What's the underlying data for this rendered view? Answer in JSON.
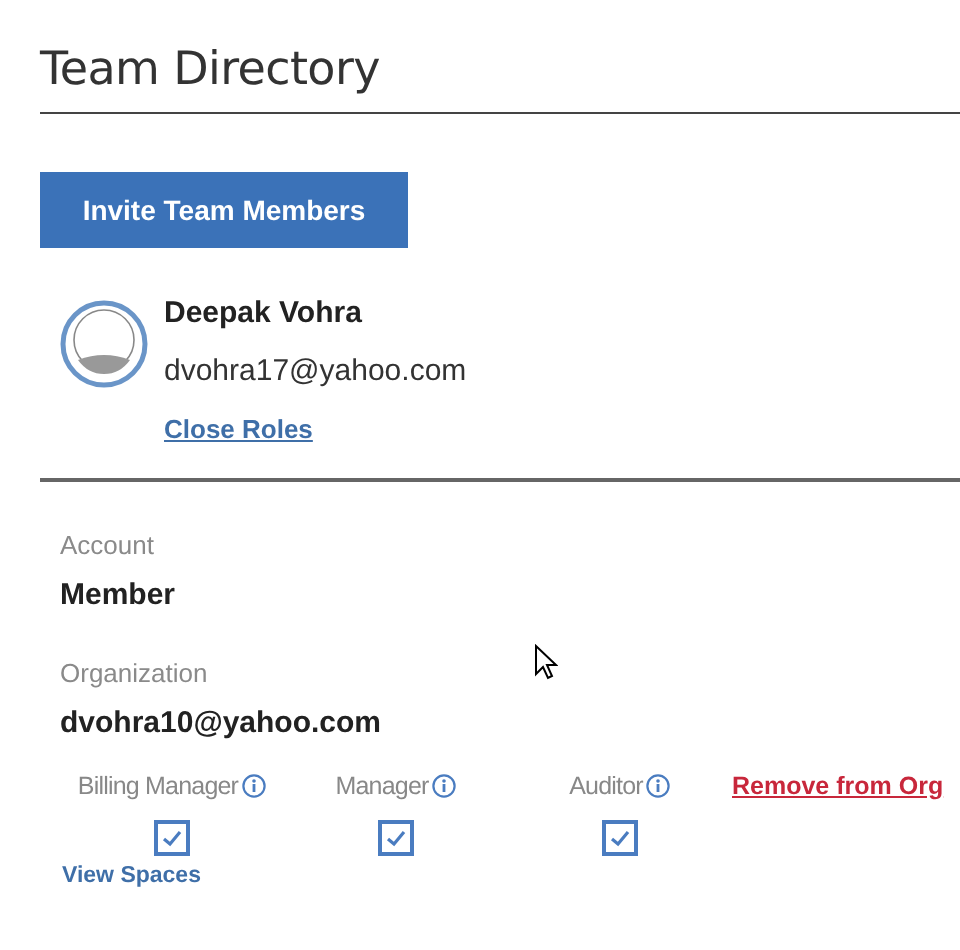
{
  "page": {
    "title": "Team Directory"
  },
  "invite_button": {
    "label": "Invite Team Members"
  },
  "member": {
    "name": "Deepak Vohra",
    "email": "dvohra17@yahoo.com",
    "close_roles_link": "Close Roles"
  },
  "account": {
    "label": "Account",
    "value": "Member"
  },
  "organization": {
    "label": "Organization",
    "value": "dvohra10@yahoo.com"
  },
  "roles": [
    {
      "label": "Billing Manager",
      "checked": true
    },
    {
      "label": "Manager",
      "checked": true
    },
    {
      "label": "Auditor",
      "checked": true
    }
  ],
  "remove_link": "Remove from Org",
  "view_spaces_link": "View Spaces"
}
